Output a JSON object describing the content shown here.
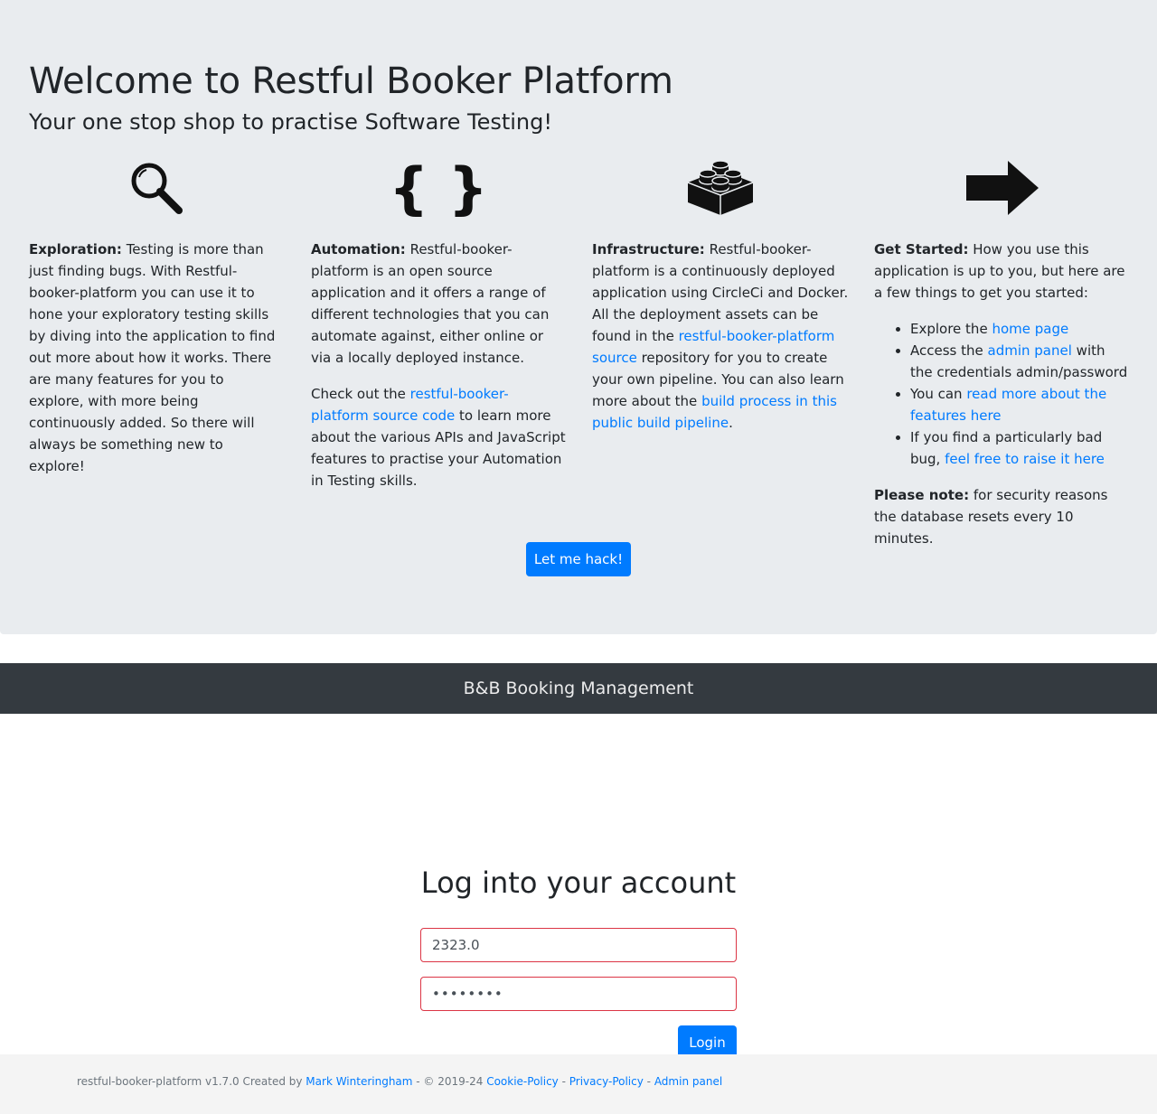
{
  "jumbotron": {
    "title": "Welcome to Restful Booker Platform",
    "subtitle": "Your one stop shop to practise Software Testing!",
    "columns": {
      "exploration": {
        "icon": "magnifying-glass-icon",
        "heading": "Exploration:",
        "text": " Testing is more than just finding bugs. With Restful-booker-platform you can use it to hone your exploratory testing skills by diving into the application to find out more about how it works. There are many features for you to explore, with more being continuously added. So there will always be something new to explore!"
      },
      "automation": {
        "icon": "curly-braces-icon",
        "heading": "Automation:",
        "text": " Restful-booker-platform is an open source application and it offers a range of different technologies that you can automate against, either online or via a locally deployed instance.",
        "p2_before": "Check out the ",
        "p2_link": "restful-booker-platform source code",
        "p2_after": " to learn more about the various APIs and JavaScript features to practise your Automation in Testing skills."
      },
      "infrastructure": {
        "icon": "lego-brick-icon",
        "heading": "Infrastructure:",
        "text_before": " Restful-booker-platform is a continuously deployed application using CircleCi and Docker. All the deployment assets can be found in the ",
        "link1": "restful-booker-platform source",
        "text_middle": " repository for you to create your own pipeline. You can also learn more about the ",
        "link2": "build process in this public build pipeline",
        "text_after": "."
      },
      "get_started": {
        "icon": "arrow-right-icon",
        "heading": "Get Started:",
        "text": " How you use this application is up to you, but here are a few things to get you started:",
        "items": [
          {
            "before": "Explore the ",
            "link": "home page",
            "after": ""
          },
          {
            "before": "Access the ",
            "link": "admin panel",
            "after": " with the credentials admin/password"
          },
          {
            "before": "You can ",
            "link": "read more about the features here",
            "after": ""
          },
          {
            "before": "If you find a particularly bad bug, ",
            "link": "feel free to raise it here",
            "after": ""
          }
        ],
        "note_heading": "Please note:",
        "note_text": " for security reasons the database resets every 10 minutes."
      }
    },
    "hack_button": "Let me hack!"
  },
  "navbar": {
    "brand": "B&B Booking Management"
  },
  "login": {
    "title": "Log into your account",
    "username_value": "2323.0",
    "password_value": "password",
    "button": "Login"
  },
  "footer": {
    "prefix": "restful-booker-platform v1.7.0 Created by ",
    "author_link": "Mark Winteringham",
    "copyright": " - © 2019-24 ",
    "cookie_link": "Cookie-Policy",
    "sep1": " - ",
    "privacy_link": "Privacy-Policy",
    "sep2": " - ",
    "admin_link": "Admin panel"
  },
  "colors": {
    "accent": "#007bff",
    "jumbotron_bg": "#e9ecef",
    "navbar_bg": "#343a40",
    "invalid_border": "#dc3545",
    "footer_bg": "#f4f4f4"
  }
}
